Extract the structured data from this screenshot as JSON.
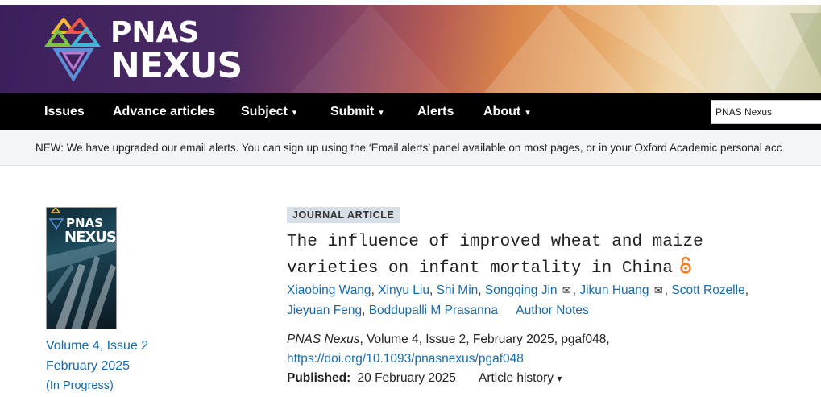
{
  "colors": {
    "nav_bg": "#000000",
    "link": "#1a6aa8",
    "badge_bg": "#d8dfe6"
  },
  "logo": {
    "line1": "PNAS",
    "line2": "NEXUS"
  },
  "nav": {
    "items": [
      {
        "label": "Issues",
        "caret": false
      },
      {
        "label": "Advance articles",
        "caret": false
      },
      {
        "label": "Subject",
        "caret": true
      },
      {
        "label": "Submit",
        "caret": true
      },
      {
        "label": "Alerts",
        "caret": false
      },
      {
        "label": "About",
        "caret": true
      }
    ],
    "caret_glyph": "▾",
    "search_value": "PNAS Nexus"
  },
  "notice": "NEW: We have upgraded our email alerts. You can sign up using the ‘Email alerts’ panel available on most pages, or in your Oxford Academic personal acc",
  "sidebar": {
    "cover_line1": "PNAS",
    "cover_line2": "NEXUS",
    "volume": "Volume 4, Issue 2",
    "date": "February 2025",
    "status": "(In Progress)"
  },
  "article": {
    "type": "JOURNAL ARTICLE",
    "title_line1": "The influence of improved wheat and maize",
    "title_line2": "varieties on infant mortality in China",
    "authors": [
      "Xiaobing Wang",
      "Xinyu Liu",
      "Shi Min",
      "Songqing Jin",
      "Jikun Huang",
      "Scott Rozelle",
      "Jieyuan Feng",
      "Boddupalli M Prasanna"
    ],
    "author_notes": "Author Notes",
    "journal": "PNAS Nexus",
    "citation": ", Volume 4, Issue 2, February 2025, pgaf048,",
    "doi": "https://doi.org/10.1093/pnasnexus/pgaf048",
    "published_label": "Published:",
    "published_date": "20 February 2025",
    "history_label": "Article history",
    "history_caret": "▾"
  }
}
